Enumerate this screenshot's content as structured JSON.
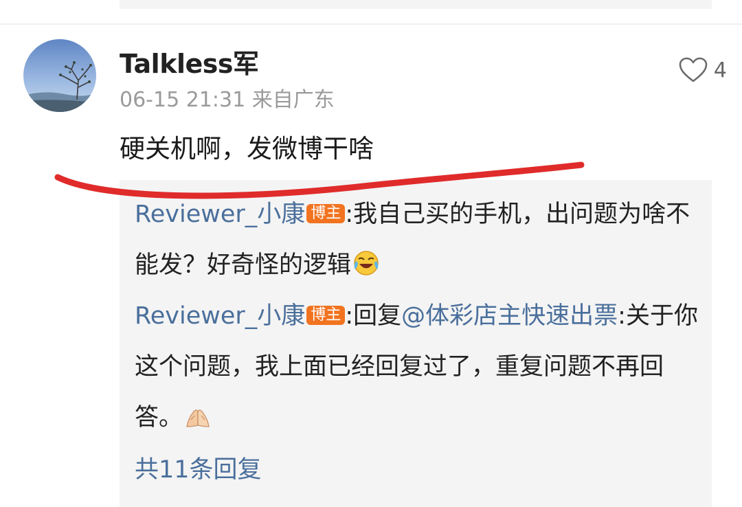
{
  "comment": {
    "username": "Talkless军",
    "date": "06-15 21:31",
    "location": "来自广东",
    "text": "硬关机啊，发微博干啥",
    "like_count": "4",
    "like_icon": "heart-outline-icon"
  },
  "replies": [
    {
      "author": "Reviewer_小康",
      "badge": "博主",
      "colon": ":",
      "text": "我自己买的手机，出问题为啥不能发？好奇怪的逻辑",
      "emoji": "laugh-cry-emoji"
    },
    {
      "author": "Reviewer_小康",
      "badge": "博主",
      "colon": ":",
      "reply_prefix": "回复",
      "mention": "@体彩店主快速出票",
      "text": ":关于你这个问题，我上面已经回复过了，重复问题不再回答。",
      "emoji": "folded-hands-emoji"
    }
  ],
  "more_replies": "共11条回复",
  "colors": {
    "link": "#4a6f9c",
    "badge": "#f2731f",
    "annotation": "#e02b2b",
    "reply_bg": "#f4f4f4"
  }
}
